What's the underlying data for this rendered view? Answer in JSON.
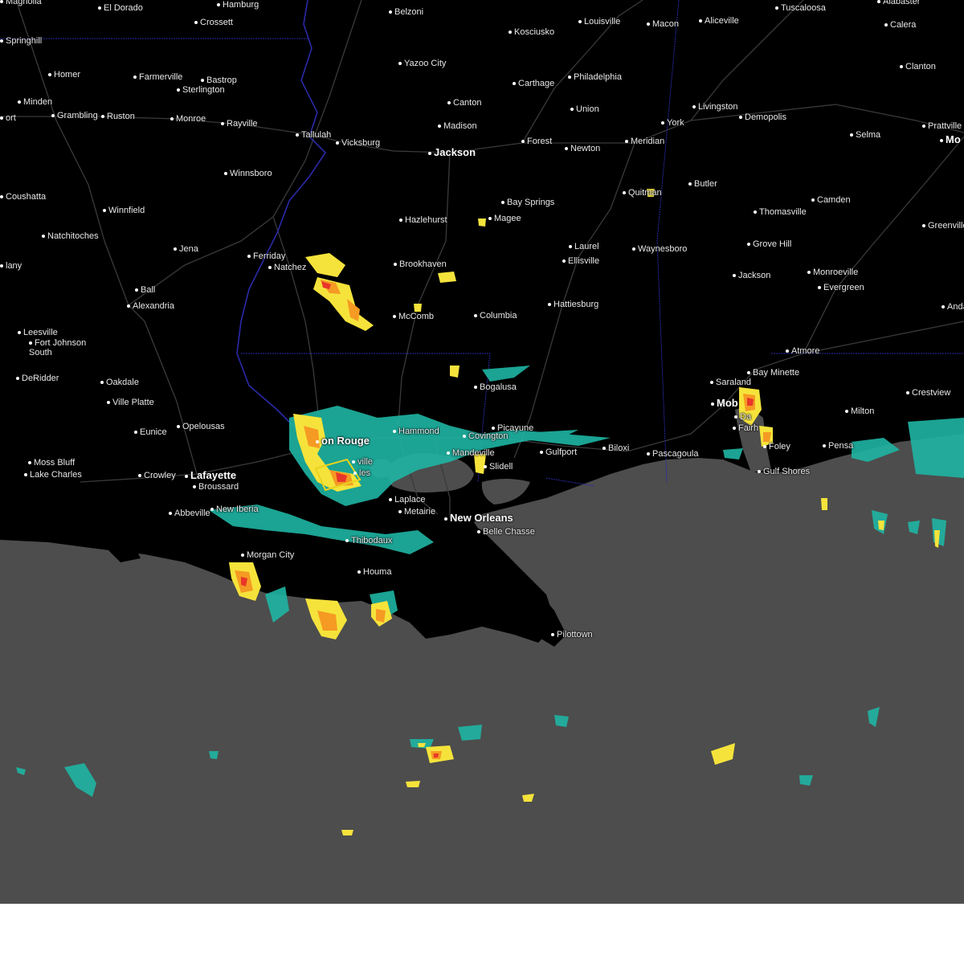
{
  "map": {
    "colors": {
      "land": "#000000",
      "water": "#4d4d4d",
      "roads": "#3a3a3a",
      "state_border": "#2a2aa8",
      "radar_light": "#1fb5a3",
      "radar_yellow": "#f5e33b",
      "radar_orange": "#f59a23",
      "radar_red": "#e8362a",
      "warning_polygon": "#e8d21f"
    },
    "labels": [
      {
        "id": "magnolia",
        "text": "Magnolia"
      },
      {
        "id": "el-dorado",
        "text": "El Dorado"
      },
      {
        "id": "hamburg",
        "text": "Hamburg"
      },
      {
        "id": "crossett",
        "text": "Crossett"
      },
      {
        "id": "belzoni",
        "text": "Belzoni"
      },
      {
        "id": "louisville",
        "text": "Louisville"
      },
      {
        "id": "macon",
        "text": "Macon"
      },
      {
        "id": "aliceville",
        "text": "Aliceville"
      },
      {
        "id": "tuscaloosa",
        "text": "Tuscaloosa"
      },
      {
        "id": "alabaster",
        "text": "Alabaster"
      },
      {
        "id": "calera",
        "text": "Calera"
      },
      {
        "id": "springhill",
        "text": "Springhill"
      },
      {
        "id": "kosciusko",
        "text": "Kosciusko"
      },
      {
        "id": "yazoo-city",
        "text": "Yazoo City"
      },
      {
        "id": "clanton",
        "text": "Clanton"
      },
      {
        "id": "homer",
        "text": "Homer"
      },
      {
        "id": "farmerville",
        "text": "Farmerville"
      },
      {
        "id": "bastrop",
        "text": "Bastrop"
      },
      {
        "id": "philadelphia",
        "text": "Philadelphia"
      },
      {
        "id": "carthage",
        "text": "Carthage"
      },
      {
        "id": "sterlington",
        "text": "Sterlington"
      },
      {
        "id": "minden",
        "text": "Minden"
      },
      {
        "id": "canton",
        "text": "Canton"
      },
      {
        "id": "livingston",
        "text": "Livingston"
      },
      {
        "id": "union",
        "text": "Union"
      },
      {
        "id": "ort",
        "text": "ort"
      },
      {
        "id": "grambling",
        "text": "Grambling"
      },
      {
        "id": "ruston",
        "text": "Ruston"
      },
      {
        "id": "monroe",
        "text": "Monroe"
      },
      {
        "id": "rayville",
        "text": "Rayville"
      },
      {
        "id": "demopolis",
        "text": "Demopolis"
      },
      {
        "id": "madison",
        "text": "Madison"
      },
      {
        "id": "york",
        "text": "York"
      },
      {
        "id": "prattville",
        "text": "Prattville"
      },
      {
        "id": "tallulah",
        "text": "Tallulah"
      },
      {
        "id": "selma",
        "text": "Selma"
      },
      {
        "id": "vicksburg",
        "text": "Vicksburg"
      },
      {
        "id": "forest",
        "text": "Forest"
      },
      {
        "id": "meridian",
        "text": "Meridian"
      },
      {
        "id": "mo",
        "text": "Mo"
      },
      {
        "id": "jackson-ms",
        "text": "Jackson"
      },
      {
        "id": "newton",
        "text": "Newton"
      },
      {
        "id": "winnsboro",
        "text": "Winnsboro"
      },
      {
        "id": "butler",
        "text": "Butler"
      },
      {
        "id": "quitman",
        "text": "Quitman"
      },
      {
        "id": "coushatta",
        "text": "Coushatta"
      },
      {
        "id": "camden",
        "text": "Camden"
      },
      {
        "id": "bay-springs",
        "text": "Bay Springs"
      },
      {
        "id": "winnfield",
        "text": "Winnfield"
      },
      {
        "id": "thomasville",
        "text": "Thomasville"
      },
      {
        "id": "hazlehurst",
        "text": "Hazlehurst"
      },
      {
        "id": "magee",
        "text": "Magee"
      },
      {
        "id": "greenville",
        "text": "Greenville"
      },
      {
        "id": "natchitoches",
        "text": "Natchitoches"
      },
      {
        "id": "grove-hill",
        "text": "Grove Hill"
      },
      {
        "id": "jena",
        "text": "Jena"
      },
      {
        "id": "laurel",
        "text": "Laurel"
      },
      {
        "id": "waynesboro",
        "text": "Waynesboro"
      },
      {
        "id": "ferriday",
        "text": "Ferriday"
      },
      {
        "id": "ellisville",
        "text": "Ellisville"
      },
      {
        "id": "brookhaven",
        "text": "Brookhaven"
      },
      {
        "id": "natchez",
        "text": "Natchez"
      },
      {
        "id": "lany",
        "text": "lany"
      },
      {
        "id": "monroeville",
        "text": "Monroeville"
      },
      {
        "id": "jackson-al",
        "text": "Jackson"
      },
      {
        "id": "evergreen",
        "text": "Evergreen"
      },
      {
        "id": "ball",
        "text": "Ball"
      },
      {
        "id": "alexandria",
        "text": "Alexandria"
      },
      {
        "id": "hattiesburg",
        "text": "Hattiesburg"
      },
      {
        "id": "andalusia",
        "text": "Andalusia"
      },
      {
        "id": "mccomb",
        "text": "McComb"
      },
      {
        "id": "columbia",
        "text": "Columbia"
      },
      {
        "id": "leesville",
        "text": "Leesville"
      },
      {
        "id": "fort-johnson",
        "text": "Fort Johnson\nSouth"
      },
      {
        "id": "atmore",
        "text": "Atmore"
      },
      {
        "id": "bay-minette",
        "text": "Bay Minette"
      },
      {
        "id": "deridder",
        "text": "DeRidder"
      },
      {
        "id": "oakdale",
        "text": "Oakdale"
      },
      {
        "id": "saraland",
        "text": "Saraland"
      },
      {
        "id": "bogalusa",
        "text": "Bogalusa"
      },
      {
        "id": "crestview",
        "text": "Crestview"
      },
      {
        "id": "mobile",
        "text": "Mob"
      },
      {
        "id": "ville-platte",
        "text": "Ville Platte"
      },
      {
        "id": "milton",
        "text": "Milton"
      },
      {
        "id": "daphne",
        "text": "Da"
      },
      {
        "id": "opelousas",
        "text": "Opelousas"
      },
      {
        "id": "hammond",
        "text": "Hammond"
      },
      {
        "id": "picayune",
        "text": "Picayune"
      },
      {
        "id": "fairhope",
        "text": "Fairh"
      },
      {
        "id": "eunice",
        "text": "Eunice"
      },
      {
        "id": "baton-rouge",
        "text": "on Rouge"
      },
      {
        "id": "covington",
        "text": "Covington"
      },
      {
        "id": "foley",
        "text": "Foley"
      },
      {
        "id": "biloxi",
        "text": "Biloxi"
      },
      {
        "id": "pensacola",
        "text": "Pensa"
      },
      {
        "id": "pascagoula",
        "text": "Pascagoula"
      },
      {
        "id": "gulfport",
        "text": "Gulfport"
      },
      {
        "id": "mandeville",
        "text": "Mandeville"
      },
      {
        "id": "slidell",
        "text": "Slidell"
      },
      {
        "id": "moss-bluff",
        "text": "Moss Bluff"
      },
      {
        "id": "lake-charles",
        "text": "Lake Charles"
      },
      {
        "id": "crowley",
        "text": "Crowley"
      },
      {
        "id": "lafayette",
        "text": "Lafayette"
      },
      {
        "id": "gulf-shores",
        "text": "Gulf Shores"
      },
      {
        "id": "broussard",
        "text": "Broussard"
      },
      {
        "id": "donaldsonville",
        "text": "ville"
      },
      {
        "id": "gonzales",
        "text": "les"
      },
      {
        "id": "laplace",
        "text": "Laplace"
      },
      {
        "id": "new-iberia",
        "text": "New Iberia"
      },
      {
        "id": "metairie",
        "text": "Metairie"
      },
      {
        "id": "abbeville",
        "text": "Abbeville"
      },
      {
        "id": "new-orleans",
        "text": "New Orleans"
      },
      {
        "id": "belle-chasse",
        "text": "Belle Chasse"
      },
      {
        "id": "thibodaux",
        "text": "Thibodaux"
      },
      {
        "id": "morgan-city",
        "text": "Morgan City"
      },
      {
        "id": "houma",
        "text": "Houma"
      },
      {
        "id": "pilottown",
        "text": "Pilottown"
      }
    ]
  }
}
